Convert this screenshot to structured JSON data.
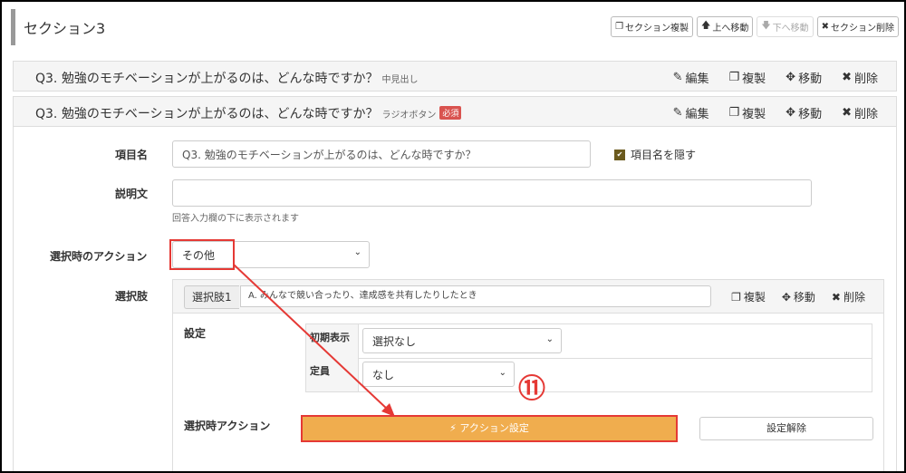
{
  "section": {
    "title": "セクション3",
    "buttons": [
      {
        "icon": "copy-icon",
        "glyph": "❐",
        "label": "セクション複製",
        "disabled": false
      },
      {
        "icon": "arrow-up-icon",
        "glyph": "🡅",
        "label": "上へ移動",
        "disabled": false
      },
      {
        "icon": "arrow-down-icon",
        "glyph": "🡇",
        "label": "下へ移動",
        "disabled": true
      },
      {
        "icon": "close-icon",
        "glyph": "✖",
        "label": "セクション削除",
        "disabled": false
      }
    ]
  },
  "question1": {
    "text": "Q3. 勉強のモチベーションが上がるのは、どんな時ですか？",
    "type": "中見出し"
  },
  "question2": {
    "text": "Q3. 勉強のモチベーションが上がるのは、どんな時ですか？",
    "type": "ラジオボタン",
    "required_badge": "必須"
  },
  "actions": {
    "edit": "編集",
    "copy": "複製",
    "move": "移動",
    "delete": "削除"
  },
  "form": {
    "item_name_label": "項目名",
    "item_name_value": "Q3. 勉強のモチベーションが上がるのは、どんな時ですか？",
    "hide_name_label": "項目名を隠す",
    "hide_name_checked": true,
    "description_label": "説明文",
    "description_value": "",
    "description_help": "回答入力欄の下に表示されます",
    "select_action_label": "選択時のアクション",
    "select_action_value": "その他",
    "choices_label": "選択肢"
  },
  "choice": {
    "tag": "選択肢1",
    "value": "A. みんなで競い合ったり、達成感を共有したりしたとき",
    "settings_label": "設定",
    "initial_display_label": "初期表示",
    "initial_display_value": "選択なし",
    "capacity_label": "定員",
    "capacity_value": "なし",
    "selected_action_label": "選択時アクション",
    "action_setting_button": "⚡ アクション設定",
    "release_button": "設定解除"
  },
  "callout": "⑪",
  "colors": {
    "accent_orange": "#f0ad4e",
    "highlight_red": "#e53935",
    "required_red": "#d9534f"
  }
}
